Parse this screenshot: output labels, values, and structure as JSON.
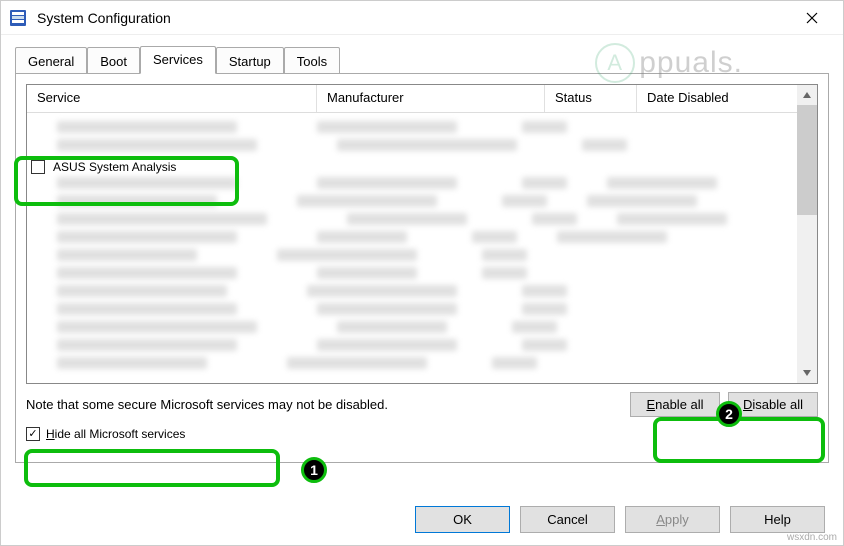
{
  "window": {
    "title": "System Configuration"
  },
  "tabs": {
    "general": "General",
    "boot": "Boot",
    "services": "Services",
    "startup": "Startup",
    "tools": "Tools"
  },
  "columns": {
    "service": "Service",
    "manufacturer": "Manufacturer",
    "status": "Status",
    "date_disabled": "Date Disabled"
  },
  "service_row": {
    "name": "ASUS System Analysis"
  },
  "note": "Note that some secure Microsoft services may not be disabled.",
  "buttons": {
    "enable_all": "Enable all",
    "disable_all": "Disable all",
    "ok": "OK",
    "cancel": "Cancel",
    "apply": "Apply",
    "help": "Help"
  },
  "checkbox": {
    "hide_ms": "Hide all Microsoft services"
  },
  "badges": {
    "one": "1",
    "two": "2"
  },
  "watermark": {
    "text": "ppuals."
  },
  "source": "wsxdn.com"
}
